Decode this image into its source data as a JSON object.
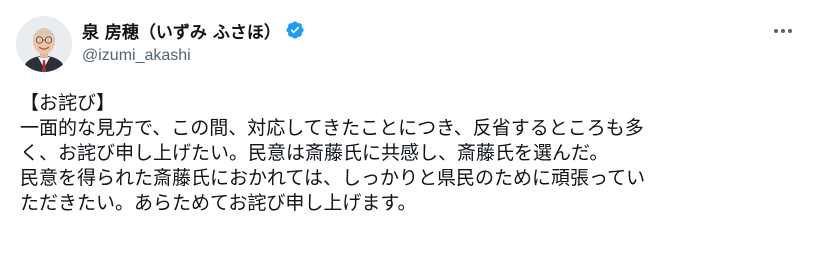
{
  "author": {
    "display_name": "泉 房穂（いずみ ふさほ）",
    "handle": "@izumi_akashi",
    "verified_icon": "verified-badge-icon",
    "verified_color": "#1d9bf0"
  },
  "menu": {
    "icon": "more-horizontal-icon"
  },
  "tweet": {
    "lines": [
      "【お詫び】",
      "一面的な見方で、この間、対応してきたことにつき、反省するところも多",
      "く、お詫び申し上げたい。民意は斎藤氏に共感し、斎藤氏を選んだ。",
      "民意を得られた斎藤氏におかれては、しっかりと県民のために頑張ってい",
      "ただきたい。あらためてお詫び申し上げます。"
    ]
  }
}
